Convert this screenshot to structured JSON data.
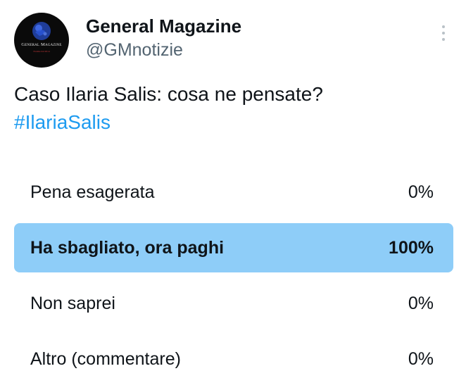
{
  "author": {
    "display_name": "General Magazine",
    "handle": "@GMnotizie",
    "avatar_text": "General Magazine",
    "avatar_subtext": "Notizie dal 2014",
    "avatar_icon": "globe-logo"
  },
  "more_icon": "more-vertical-icon",
  "tweet": {
    "text": "Caso Ilaria Salis: cosa ne pensate?",
    "hashtag": "#IlariaSalis"
  },
  "poll": {
    "accent_color": "#8ecdf8",
    "options": [
      {
        "label": "Pena esagerata",
        "percent_text": "0%",
        "percent": 0,
        "winner": false
      },
      {
        "label": "Ha sbagliato, ora paghi",
        "percent_text": "100%",
        "percent": 100,
        "winner": true
      },
      {
        "label": "Non saprei",
        "percent_text": "0%",
        "percent": 0,
        "winner": false
      },
      {
        "label": "Altro (commentare)",
        "percent_text": "0%",
        "percent": 0,
        "winner": false
      }
    ]
  }
}
